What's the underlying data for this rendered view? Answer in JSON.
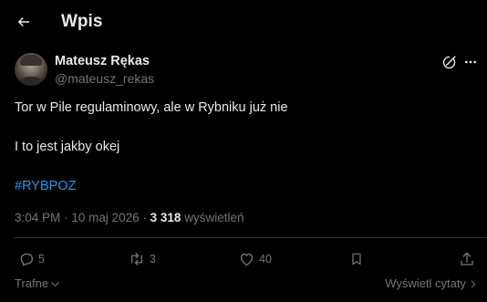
{
  "header": {
    "title": "Wpis",
    "back_icon": "arrow-left-icon"
  },
  "author": {
    "display_name": "Mateusz Rękas",
    "handle": "@mateusz_rekas",
    "avatar_icon": "user-avatar"
  },
  "tweet": {
    "lines": [
      "Tor w Pile regulaminowy, ale w Rybniku już nie",
      "I to jest jakby okej"
    ],
    "hashtag": "#RYBPOZ"
  },
  "meta": {
    "time": "3:04 PM",
    "separator": "·",
    "date": "10 maj 2026",
    "views_count": "3 318",
    "views_label": "wyświetleń"
  },
  "actions": {
    "replies": "5",
    "reposts": "3",
    "likes": "40"
  },
  "footer": {
    "sort_label": "Trafne",
    "quotes_label": "Wyświetl cytaty"
  },
  "colors": {
    "background": "#000000",
    "text": "#e7e9ea",
    "muted": "#71767b",
    "accent": "#1d9bf0",
    "divider": "#2f3336"
  }
}
